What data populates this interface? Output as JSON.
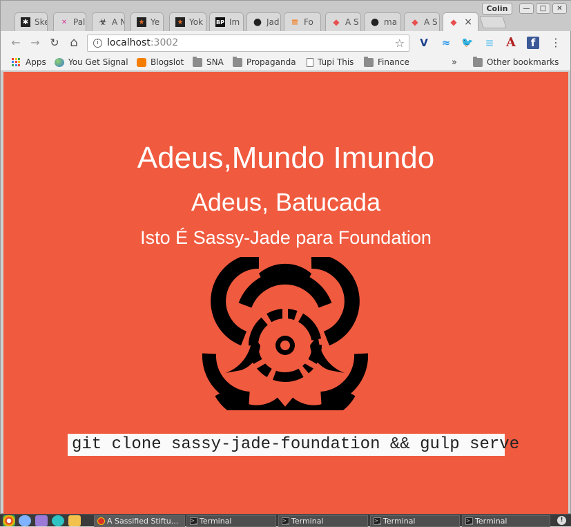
{
  "window": {
    "profile_name": "Colin",
    "minimize_symbol": "—",
    "maximize_symbol": "□",
    "close_symbol": "✕"
  },
  "tabs": [
    {
      "title": "Ske",
      "icon": "asterisk-icon",
      "icon_glyph": "✱",
      "icon_color": "#222"
    },
    {
      "title": "Pal",
      "icon": "palette-icon",
      "icon_glyph": "✕",
      "icon_color": "#d6369a"
    },
    {
      "title": "A N",
      "icon": "biohazard-icon",
      "icon_glyph": "☣",
      "icon_color": "#222"
    },
    {
      "title": "Ye",
      "icon": "star-icon",
      "icon_glyph": "★",
      "icon_color": "#e8702a"
    },
    {
      "title": "Yok",
      "icon": "star-icon",
      "icon_glyph": "★",
      "icon_color": "#e8702a"
    },
    {
      "title": "Im",
      "icon": "bp-icon",
      "icon_glyph": "BP",
      "icon_color": "#111"
    },
    {
      "title": "Jad",
      "icon": "github-icon",
      "icon_glyph": "●",
      "icon_color": "#222"
    },
    {
      "title": "Fo",
      "icon": "stackoverflow-icon",
      "icon_glyph": "≡",
      "icon_color": "#f48024"
    },
    {
      "title": "A S",
      "icon": "foundation-icon",
      "icon_glyph": "◆",
      "icon_color": "#e94e4e"
    },
    {
      "title": "ma",
      "icon": "github-icon",
      "icon_glyph": "●",
      "icon_color": "#222"
    },
    {
      "title": "A S",
      "icon": "foundation-icon",
      "icon_glyph": "◆",
      "icon_color": "#e94e4e"
    },
    {
      "title": "",
      "icon": "foundation-icon",
      "icon_glyph": "◆",
      "icon_color": "#e94e4e",
      "active": true
    }
  ],
  "active_tab_close": "×",
  "toolbar": {
    "url_host": "localhost",
    "url_port": ":3002",
    "back_glyph": "←",
    "forward_glyph": "→",
    "reload_glyph": "↻",
    "home_glyph": "⌂",
    "star_glyph": "☆",
    "info_glyph": "i",
    "menu_glyph": "⋮",
    "extensions": [
      {
        "name": "vimeo-icon",
        "glyph": "V",
        "color": "#1a3f8a"
      },
      {
        "name": "docker-icon",
        "glyph": "≈",
        "color": "#2496ed"
      },
      {
        "name": "twitter-icon",
        "glyph": "🐦",
        "color": "#1da1f2"
      },
      {
        "name": "stripes-icon",
        "glyph": "≡",
        "color": "#6ec6f0"
      },
      {
        "name": "font-a-icon",
        "glyph": "A",
        "color": "#b22222"
      },
      {
        "name": "facebook-icon",
        "glyph": "f",
        "color": "#ffffff"
      }
    ]
  },
  "bookmarks": {
    "items": [
      {
        "label": "Apps",
        "icon": "apps-grid-icon"
      },
      {
        "label": "You Get Signal",
        "icon": "globe-icon"
      },
      {
        "label": "Blogslot",
        "icon": "blogger-icon"
      },
      {
        "label": "SNA",
        "icon": "folder-icon"
      },
      {
        "label": "Propaganda",
        "icon": "folder-icon"
      },
      {
        "label": "Tupi This",
        "icon": "page-icon"
      },
      {
        "label": "Finance",
        "icon": "folder-icon"
      }
    ],
    "overflow_glyph": "»",
    "other_label": "Other bookmarks"
  },
  "page": {
    "heading": "Adeus,Mundo Imundo",
    "subheading": "Adeus, Batucada",
    "tagline": "Isto É Sassy-Jade para Foundation",
    "command": "git clone sassy-jade-foundation && gulp serve",
    "background_color": "#f05a3f",
    "symbol": "biohazard-icon"
  },
  "taskbar": {
    "launchers": [
      {
        "name": "chrome-launcher-icon",
        "color": "#d93025"
      },
      {
        "name": "cloud-launcher-icon",
        "color": "#7fb3ff"
      },
      {
        "name": "notes-launcher-icon",
        "color": "#9a7ad6"
      },
      {
        "name": "settings-launcher-icon",
        "color": "#2ec4c4"
      },
      {
        "name": "files-launcher-icon",
        "color": "#f2c14e"
      }
    ],
    "tasks": [
      {
        "label": "A Sassified Stiftu...",
        "icon_glyph": "●",
        "active": true
      },
      {
        "label": "Terminal",
        "icon_glyph": ">_"
      },
      {
        "label": "Terminal",
        "icon_glyph": ">_"
      },
      {
        "label": "Terminal",
        "icon_glyph": ">_"
      },
      {
        "label": "Terminal",
        "icon_glyph": ">_"
      }
    ],
    "alert_glyph": "!"
  }
}
